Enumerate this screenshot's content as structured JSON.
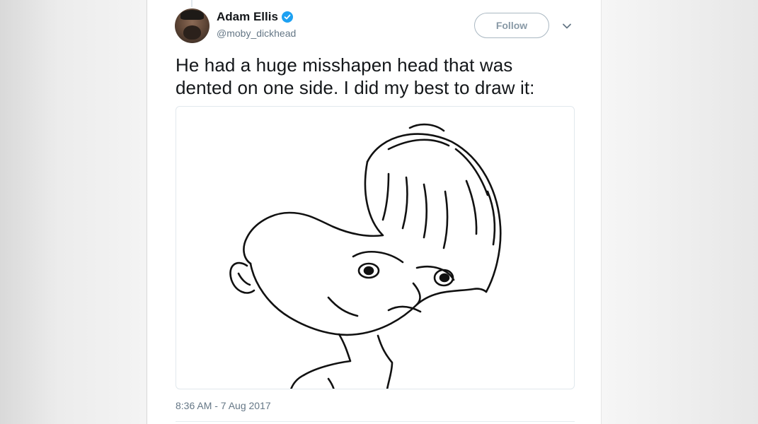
{
  "tweet": {
    "author_name": "Adam Ellis",
    "handle": "@moby_dickhead",
    "verified": true,
    "follow_label": "Follow",
    "text_line1": "He had a huge misshapen head that was",
    "text_line2": "dented on one side. I did my best to draw it:",
    "timestamp": "8:36 AM - 7 Aug 2017"
  },
  "icons": {
    "verified": "verified-badge-icon",
    "menu": "chevron-down-icon"
  },
  "colors": {
    "verified_blue": "#1da1f2",
    "text_primary": "#14171a",
    "text_secondary": "#657786",
    "follow_border": "#aab8c2"
  }
}
